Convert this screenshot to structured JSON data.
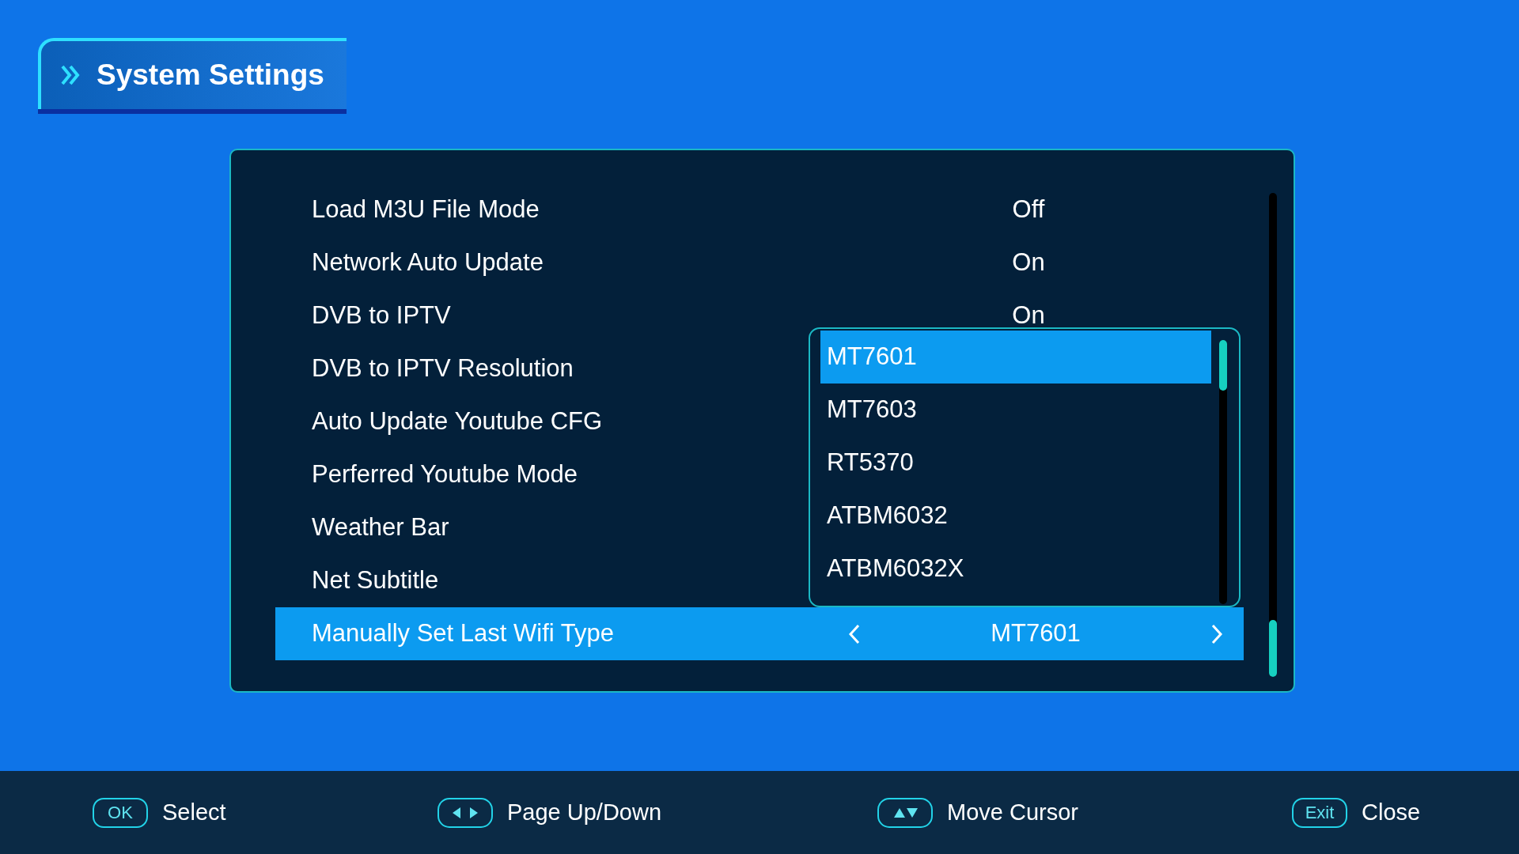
{
  "header": {
    "title": "System Settings"
  },
  "settings": [
    {
      "label": "Load M3U File Mode",
      "value": "Off",
      "selected": false
    },
    {
      "label": "Network Auto Update",
      "value": "On",
      "selected": false
    },
    {
      "label": "DVB to IPTV",
      "value": "On",
      "selected": false
    },
    {
      "label": "DVB to IPTV Resolution",
      "selected": false
    },
    {
      "label": "Auto Update Youtube CFG",
      "selected": false
    },
    {
      "label": "Perferred Youtube Mode",
      "selected": false
    },
    {
      "label": "Weather Bar",
      "selected": false
    },
    {
      "label": "Net Subtitle",
      "selected": false
    },
    {
      "label": "Manually Set Last Wifi Type",
      "value": "MT7601",
      "selected": true
    }
  ],
  "dropdown": {
    "options": [
      {
        "label": "MT7601",
        "selected": true
      },
      {
        "label": "MT7603",
        "selected": false
      },
      {
        "label": "RT5370",
        "selected": false
      },
      {
        "label": "ATBM6032",
        "selected": false
      },
      {
        "label": "ATBM6032X",
        "selected": false
      }
    ]
  },
  "footer": [
    {
      "key": "OK",
      "kind": "text",
      "label": "Select"
    },
    {
      "kind": "leftright",
      "label": "Page Up/Down"
    },
    {
      "kind": "updown",
      "label": "Move Cursor"
    },
    {
      "key": "Exit",
      "kind": "text",
      "label": "Close"
    }
  ]
}
